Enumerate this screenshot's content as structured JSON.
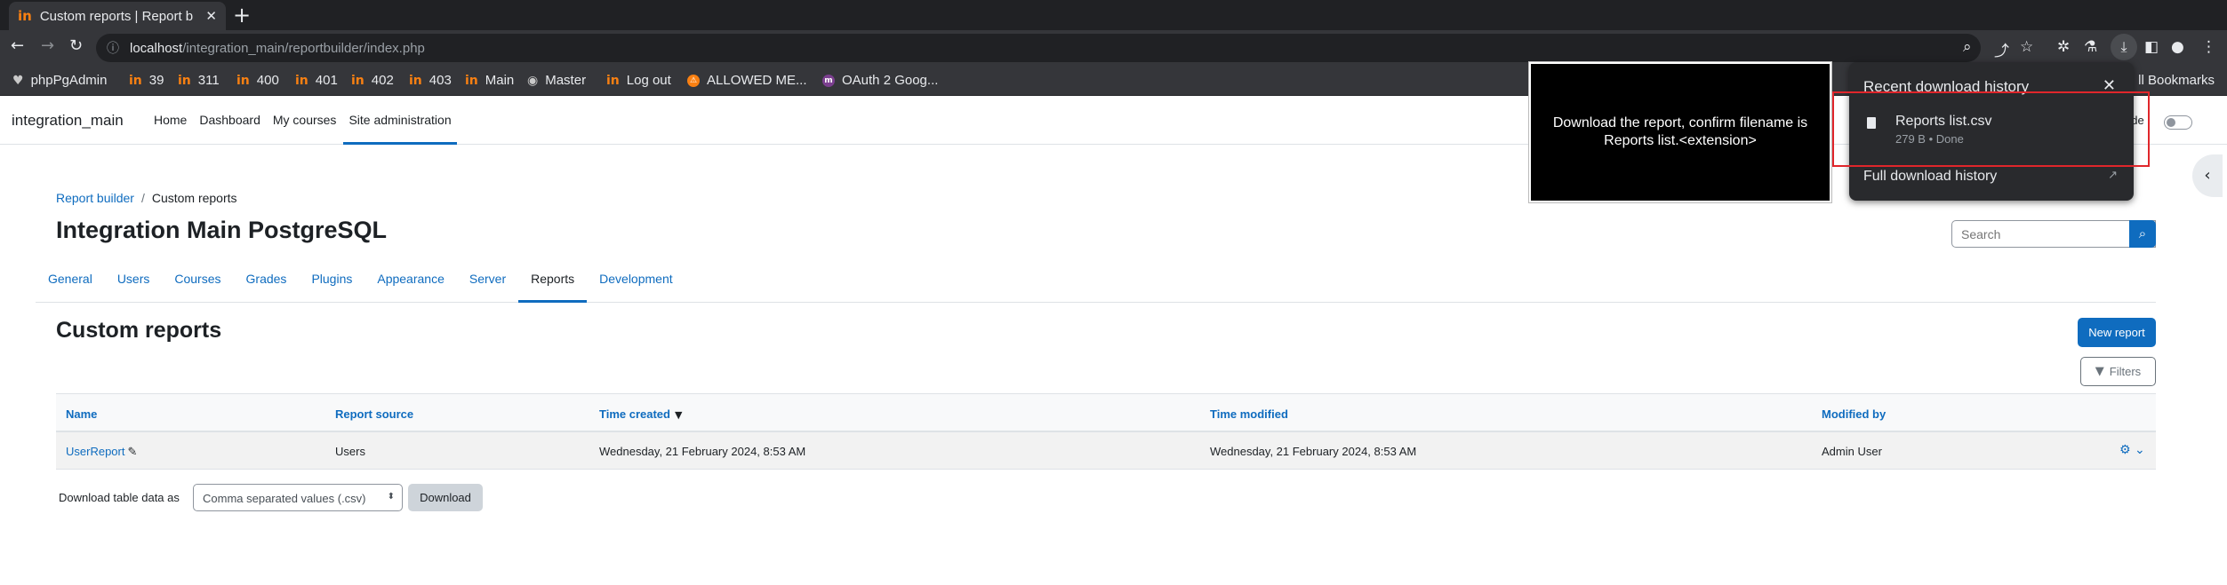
{
  "browser": {
    "tab_title": "Custom reports | Report b",
    "tab_close": "✕",
    "new_tab": "+",
    "url_host": "localhost",
    "url_path": "/integration_main/reportbuilder/index.php",
    "bookmarks": [
      {
        "icon": "♥",
        "label": "phpPgAdmin"
      },
      {
        "icon": "in",
        "label": "39"
      },
      {
        "icon": "in",
        "label": "311"
      },
      {
        "icon": "in",
        "label": "400"
      },
      {
        "icon": "in",
        "label": "401"
      },
      {
        "icon": "in",
        "label": "402"
      },
      {
        "icon": "in",
        "label": "403"
      },
      {
        "icon": "in",
        "label": "Main"
      },
      {
        "icon": "◉",
        "label": "Master"
      },
      {
        "icon": "in",
        "label": "Log out"
      },
      {
        "icon": "⚠",
        "label": "ALLOWED ME..."
      },
      {
        "icon": "m",
        "label": "OAuth 2 Goog..."
      }
    ],
    "all_bookmarks": "ll Bookmarks"
  },
  "navbar": {
    "site_name": "integration_main",
    "items": [
      "Home",
      "Dashboard",
      "My courses",
      "Site administration"
    ],
    "edit_mode_label": "ode"
  },
  "page": {
    "breadcrumb": [
      "Report builder",
      "Custom reports"
    ],
    "breadcrumb_sep": "/",
    "title": "Integration Main PostgreSQL",
    "search_placeholder": "Search",
    "secondary_nav": [
      "General",
      "Users",
      "Courses",
      "Grades",
      "Plugins",
      "Appearance",
      "Server",
      "Reports",
      "Development"
    ],
    "section_title": "Custom reports",
    "new_report": "New report",
    "filters": "Filters"
  },
  "table": {
    "headers": [
      "Name",
      "Report source",
      "Time created",
      "Time modified",
      "Modified by"
    ],
    "rows": [
      {
        "name": "UserReport",
        "source": "Users",
        "created": "Wednesday, 21 February 2024, 8:53 AM",
        "modified": "Wednesday, 21 February 2024, 8:53 AM",
        "modified_by": "Admin User"
      }
    ]
  },
  "download": {
    "label": "Download table data as",
    "selected": "Comma separated values (.csv)",
    "button": "Download"
  },
  "instruction": {
    "text": "Download the report, confirm filename is Reports list.<extension>"
  },
  "download_panel": {
    "title": "Recent download history",
    "close": "✕",
    "file_name": "Reports list.csv",
    "file_meta": "279 B • Done",
    "full_history": "Full download history"
  },
  "colors": {
    "brand": "#0f6cbf",
    "highlight": "#e0262b",
    "chrome_dark": "#202124"
  }
}
